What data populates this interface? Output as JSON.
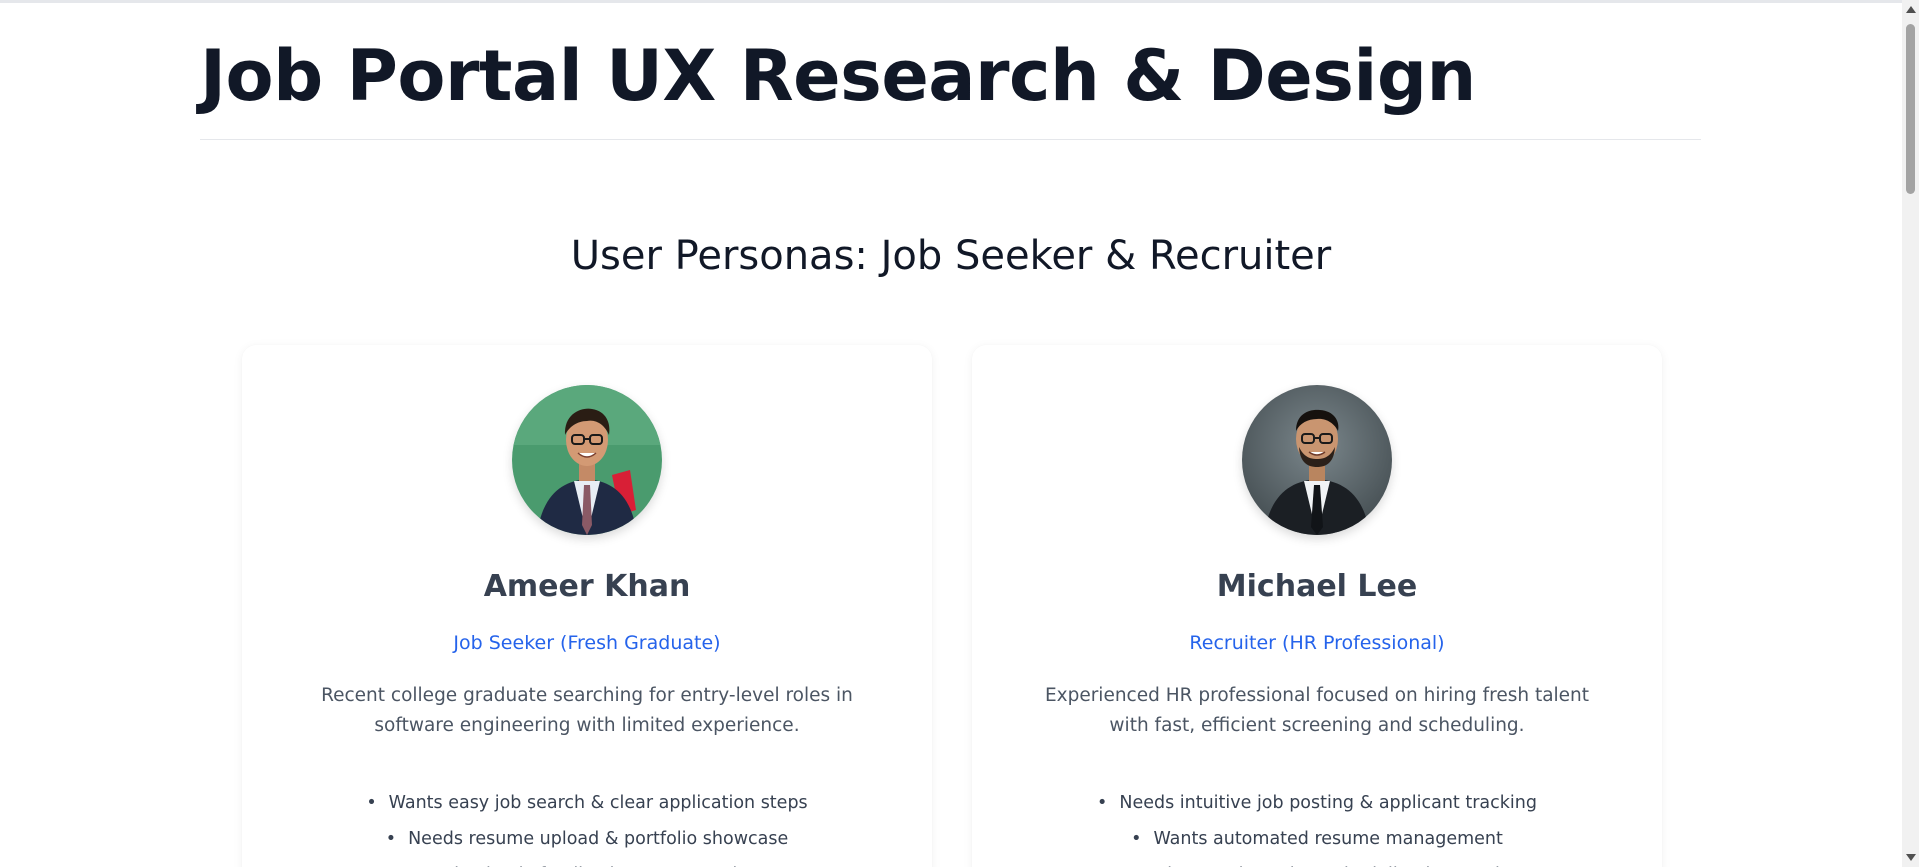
{
  "page": {
    "title": "Job Portal UX Research & Design"
  },
  "section": {
    "title": "User Personas: Job Seeker & Recruiter"
  },
  "personas": [
    {
      "name": "Ameer Khan",
      "role": "Job Seeker (Fresh Graduate)",
      "description": "Recent college graduate searching for entry-level roles in software engineering with limited experience.",
      "bullets": [
        "Wants easy job search & clear application steps",
        "Needs resume upload & portfolio showcase",
        "Seeks timely feedback & status updates"
      ],
      "avatar_bg": "#4a9b6e"
    },
    {
      "name": "Michael Lee",
      "role": "Recruiter (HR Professional)",
      "description": "Experienced HR professional focused on hiring fresh talent with fast, efficient screening and scheduling.",
      "bullets": [
        "Needs intuitive job posting & applicant tracking",
        "Wants automated resume management",
        "Seeks easy interview scheduling integration"
      ],
      "avatar_bg": "#5f6b70"
    }
  ],
  "colors": {
    "accent": "#2563eb",
    "heading": "#111827",
    "body_text": "#4b5563"
  }
}
